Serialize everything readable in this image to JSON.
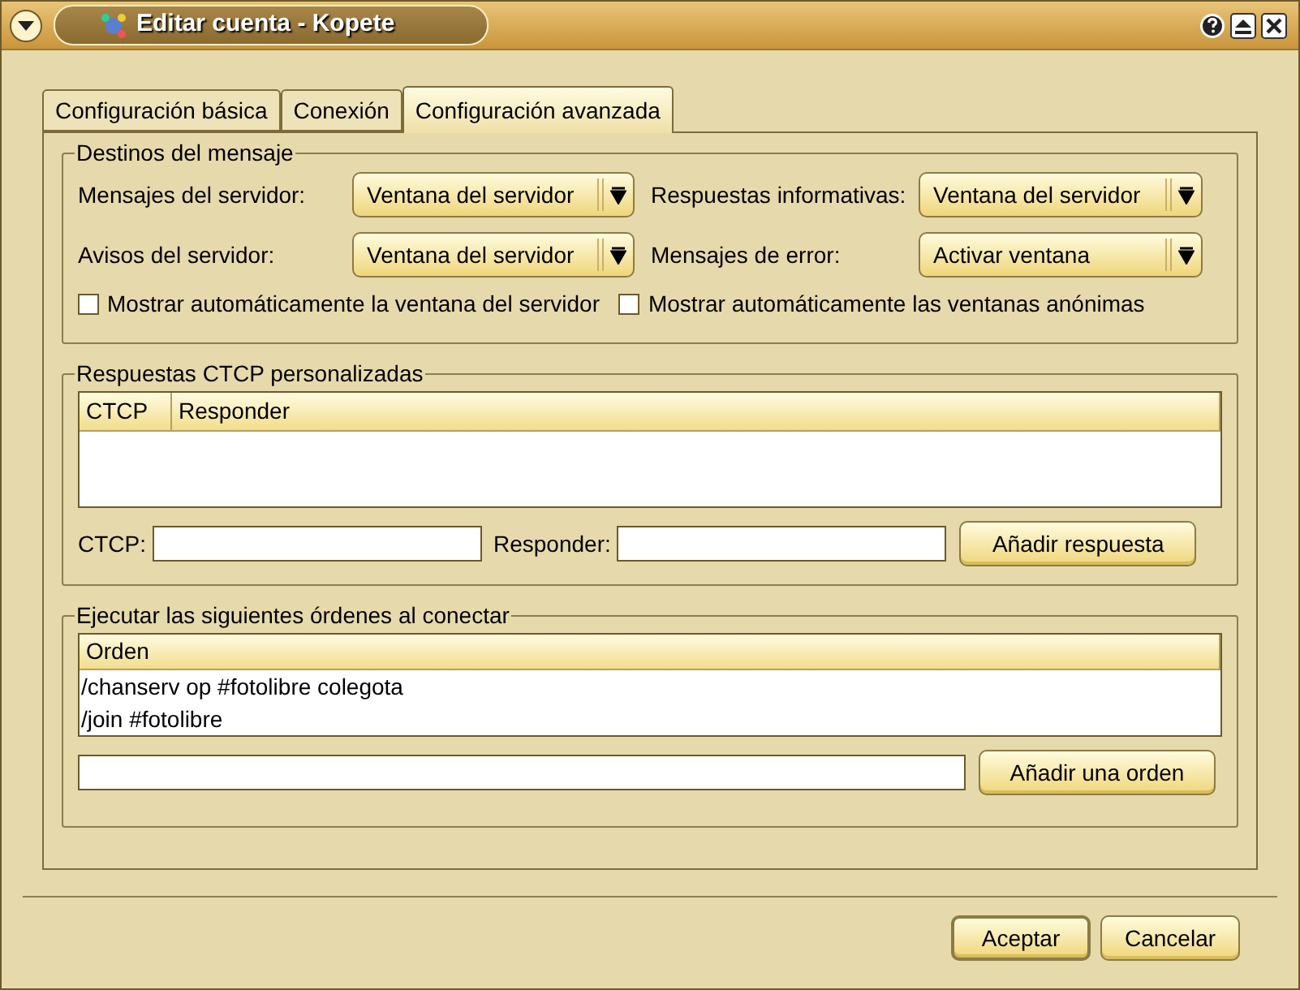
{
  "window": {
    "title": "Editar cuenta - Kopete"
  },
  "tabs": [
    {
      "label": "Configuración básica",
      "selected": false
    },
    {
      "label": "Conexión",
      "selected": false
    },
    {
      "label": "Configuración avanzada",
      "selected": true
    }
  ],
  "message_destinations": {
    "title": "Destinos del mensaje",
    "fields": [
      {
        "label": "Mensajes del servidor:",
        "value": "Ventana del servidor"
      },
      {
        "label": "Respuestas informativas:",
        "value": "Ventana del servidor"
      },
      {
        "label": "Avisos del servidor:",
        "value": "Ventana del servidor"
      },
      {
        "label": "Mensajes de error:",
        "value": "Activar ventana"
      }
    ],
    "checkboxes": [
      {
        "label": "Mostrar automáticamente la ventana del servidor",
        "checked": false
      },
      {
        "label": "Mostrar automáticamente las ventanas anónimas",
        "checked": false
      }
    ]
  },
  "ctcp_replies": {
    "title": "Respuestas CTCP personalizadas",
    "columns": [
      "CTCP",
      "Responder"
    ],
    "inputs": [
      {
        "label": "CTCP:"
      },
      {
        "label": "Responder:"
      }
    ],
    "button": "Añadir respuesta"
  },
  "connect_commands": {
    "title": "Ejecutar las siguientes órdenes al conectar",
    "columns": [
      "Orden"
    ],
    "rows": [
      "/chanserv op #fotolibre colegota",
      "/join #fotolibre"
    ],
    "button": "Añadir una orden"
  },
  "buttons": [
    {
      "label": "Aceptar",
      "default": true
    },
    {
      "label": "Cancelar",
      "default": false
    }
  ]
}
